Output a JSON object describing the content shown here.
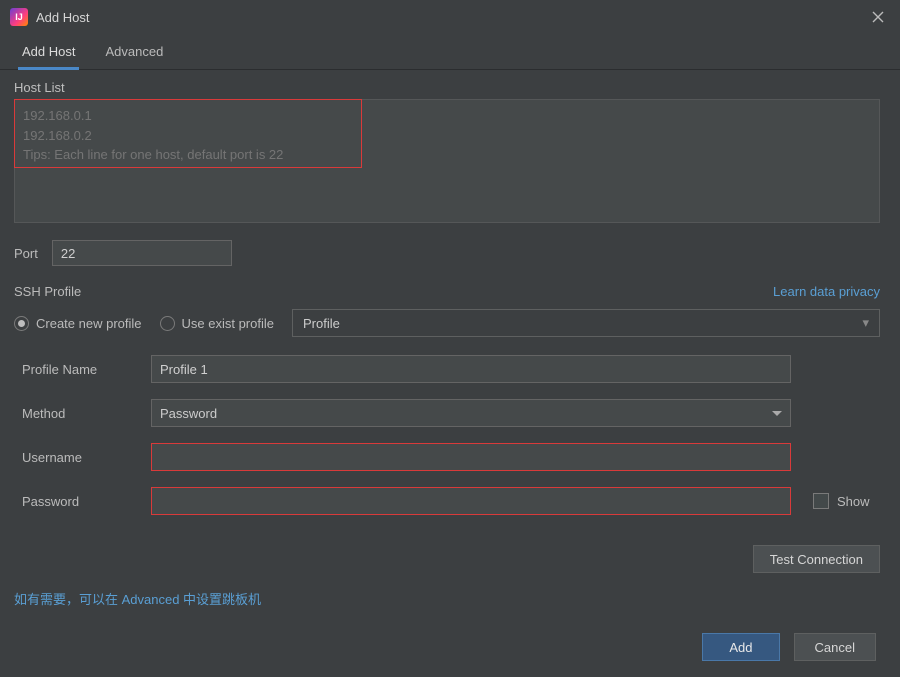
{
  "window": {
    "title": "Add Host"
  },
  "tabs": {
    "add_host": "Add Host",
    "advanced": "Advanced"
  },
  "host_list": {
    "label": "Host List",
    "placeholder": "192.168.0.1\n192.168.0.2\nTips: Each line for one host, default port is 22"
  },
  "port": {
    "label": "Port",
    "value": "22"
  },
  "ssh": {
    "label": "SSH Profile",
    "learn_link": "Learn data privacy",
    "create_new": "Create new profile",
    "use_exist": "Use exist profile",
    "profile_select": "Profile"
  },
  "form": {
    "profile_name_label": "Profile Name",
    "profile_name_value": "Profile 1",
    "method_label": "Method",
    "method_value": "Password",
    "username_label": "Username",
    "username_value": "",
    "password_label": "Password",
    "password_value": "",
    "show_label": "Show"
  },
  "buttons": {
    "test": "Test Connection",
    "add": "Add",
    "cancel": "Cancel"
  },
  "tip": "如有需要，可以在 Advanced 中设置跳板机"
}
